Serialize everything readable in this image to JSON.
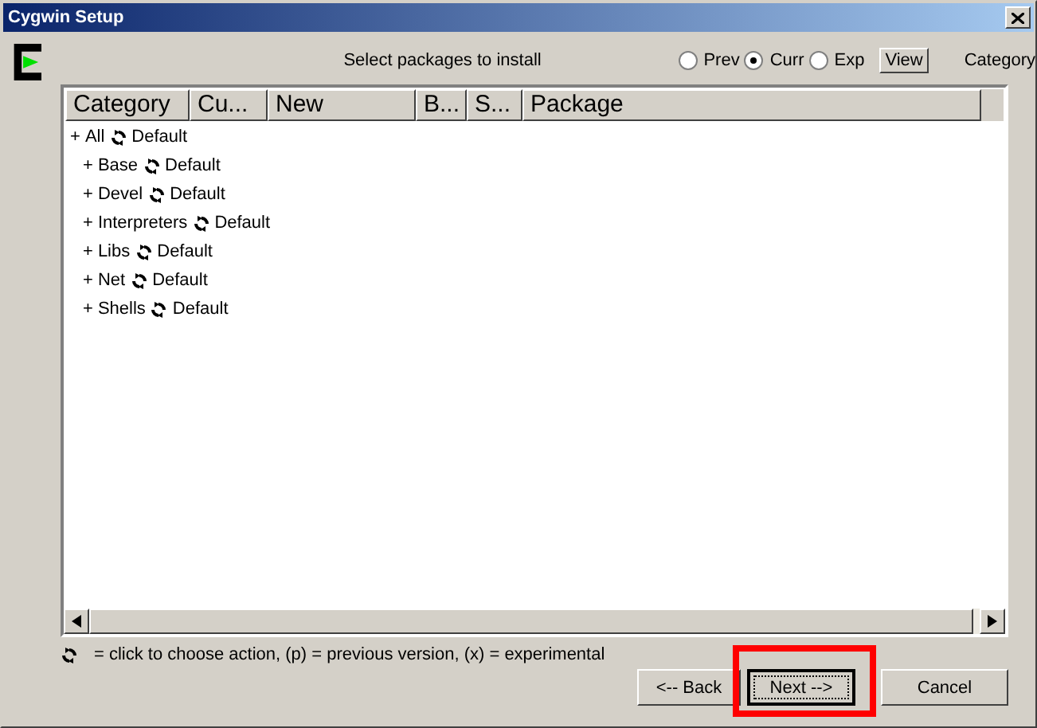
{
  "window": {
    "title": "Cygwin Setup"
  },
  "header": {
    "prompt": "Select packages to install",
    "view_options": [
      {
        "label": "Prev",
        "selected": false
      },
      {
        "label": "Curr",
        "selected": true
      },
      {
        "label": "Exp",
        "selected": false
      }
    ],
    "view_button": "View",
    "view_mode": "Category"
  },
  "table": {
    "columns": [
      "Category",
      "Cu...",
      "New",
      "B...",
      "S...",
      "Package"
    ],
    "tree": [
      {
        "toggle": "+",
        "label": "All",
        "action": "Default",
        "children": [
          {
            "toggle": "+",
            "label": "Base",
            "action": "Default"
          },
          {
            "toggle": "+",
            "label": "Devel",
            "action": "Default"
          },
          {
            "toggle": "+",
            "label": "Interpreters",
            "action": "Default"
          },
          {
            "toggle": "+",
            "label": "Libs",
            "action": "Default"
          },
          {
            "toggle": "+",
            "label": "Net",
            "action": "Default"
          },
          {
            "toggle": "+",
            "label": "Shells",
            "action": "Default"
          }
        ]
      }
    ]
  },
  "legend": "= click to choose action, (p) = previous version, (x) = experimental",
  "buttons": [
    {
      "label": "<-- Back",
      "kind": "normal"
    },
    {
      "label": "Next -->",
      "kind": "default"
    },
    {
      "label": "Cancel",
      "kind": "normal"
    }
  ]
}
